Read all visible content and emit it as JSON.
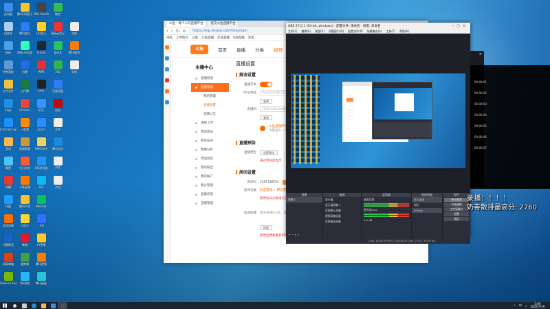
{
  "desktop_icons": [
    {
      "label": "此电脑",
      "color": "#3a8ee6"
    },
    {
      "label": "腾讯QQ音乐",
      "color": "#f4c531"
    },
    {
      "label": "OBS Studio",
      "color": "#444"
    },
    {
      "label": "微信",
      "color": "#2fbf4f"
    },
    {
      "label": "",
      "color": ""
    },
    {
      "label": "回收站",
      "color": "#aaccee"
    },
    {
      "label": "腾讯会议",
      "color": "#2d7cf6"
    },
    {
      "label": "QQ音乐",
      "color": "#fdd12d"
    },
    {
      "label": "网易云音乐",
      "color": "#e33"
    },
    {
      "label": "文档",
      "color": "#eee"
    },
    {
      "label": "网络",
      "color": "#4aa0e6"
    },
    {
      "label": "网易UU加速",
      "color": "#3fb"
    },
    {
      "label": "Steam",
      "color": "#1b2838"
    },
    {
      "label": "爱奇艺",
      "color": "#22c55e"
    },
    {
      "label": "腾讯视频",
      "color": "#ff7b00"
    },
    {
      "label": "控制面板",
      "color": "#5b9bd5"
    },
    {
      "label": "迅雷",
      "color": "#1e6fe6"
    },
    {
      "label": "WPS",
      "color": "#d33"
    },
    {
      "label": "360",
      "color": "#2fb24f"
    },
    {
      "label": "文档",
      "color": "#eee"
    },
    {
      "label": "工作文件",
      "color": "#f0c040"
    },
    {
      "label": "工作簿",
      "color": "#1d7a3f"
    },
    {
      "label": "EPIC",
      "color": "#222"
    },
    {
      "label": "百度网盘",
      "color": "#2f7cf6"
    },
    {
      "label": "",
      "color": ""
    },
    {
      "label": "Edge",
      "color": "#1f8fe0"
    },
    {
      "label": "Chrome",
      "color": "#e8453c"
    },
    {
      "label": "钉钉",
      "color": "#3296fa"
    },
    {
      "label": "网易",
      "color": "#c20c0c"
    },
    {
      "label": "",
      "color": ""
    },
    {
      "label": "Internet Explorer",
      "color": "#1e90ff"
    },
    {
      "label": "一起看",
      "color": "#ff8a00"
    },
    {
      "label": "Zoom",
      "color": "#2d8cff"
    },
    {
      "label": "文件",
      "color": "#eee"
    },
    {
      "label": "",
      "color": ""
    },
    {
      "label": "游戏",
      "color": "#ffb84d"
    },
    {
      "label": "英雄联盟",
      "color": "#c89b3c"
    },
    {
      "label": "WeGame",
      "color": "#f0d060"
    },
    {
      "label": "腾讯文档",
      "color": "#1e88e5"
    },
    {
      "label": "",
      "color": ""
    },
    {
      "label": "截图",
      "color": "#4fc3f7"
    },
    {
      "label": "金山文档",
      "color": "#ff5a36"
    },
    {
      "label": "QQ浏览器",
      "color": "#2196f3"
    },
    {
      "label": "PPT",
      "color": "#eee"
    },
    {
      "label": "",
      "color": ""
    },
    {
      "label": "快播",
      "color": "#e53935"
    },
    {
      "label": "斗鱼直播",
      "color": "#ff7a00"
    },
    {
      "label": "QQ",
      "color": "#12b7f5"
    },
    {
      "label": "文档",
      "color": "#eee"
    },
    {
      "label": "",
      "color": ""
    },
    {
      "label": "优酷",
      "color": "#1e9bff"
    },
    {
      "label": "腾讯手游",
      "color": "#fbc02d"
    },
    {
      "label": "WeChat",
      "color": "#07c160"
    },
    {
      "label": "",
      "color": ""
    },
    {
      "label": "",
      "color": ""
    },
    {
      "label": "游戏加速",
      "color": "#ff6f00"
    },
    {
      "label": "斗地主",
      "color": "#fdd835"
    },
    {
      "label": "飞书",
      "color": "#3370ff"
    },
    {
      "label": "",
      "color": ""
    },
    {
      "label": "",
      "color": ""
    },
    {
      "label": "迅雷影音",
      "color": "#1565c0"
    },
    {
      "label": "微博",
      "color": "#e6162d"
    },
    {
      "label": "YY直播",
      "color": "#ffca28"
    },
    {
      "label": "",
      "color": ""
    },
    {
      "label": "",
      "color": ""
    },
    {
      "label": "网易邮箱",
      "color": "#d84315"
    },
    {
      "label": "爱剪辑",
      "color": "#43a047"
    },
    {
      "label": "腾讯视频",
      "color": "#ff7b00"
    },
    {
      "label": "",
      "color": ""
    },
    {
      "label": "",
      "color": ""
    },
    {
      "label": "GeForce Experience",
      "color": "#76b900"
    },
    {
      "label": "QQ游戏",
      "color": "#29b6f6"
    },
    {
      "label": "腾讯桌面",
      "color": "#26c6da"
    },
    {
      "label": "",
      "color": ""
    },
    {
      "label": "",
      "color": ""
    }
  ],
  "browser": {
    "tabs": [
      "斗鱼 - 每个人的直播平台",
      "提交斗鱼直播平台"
    ],
    "url": "https://mp.douyu.com/live/main",
    "bookmarks": [
      "书签",
      "上传照片",
      "斗鱼",
      "斗鱼直播",
      "虎牙直播",
      "B站直播",
      "淘宝"
    ],
    "logo": "斗鱼",
    "nav": [
      "首页",
      "直播",
      "分类",
      "视频"
    ],
    "menu_title": "主播中心",
    "menu": [
      {
        "label": "直播频道",
        "state": ""
      },
      {
        "label": "直播管理",
        "state": "active"
      },
      {
        "label": "我的管理",
        "state": "sub"
      },
      {
        "label": "直播设置",
        "state": "sub-orange"
      },
      {
        "label": "直播公告",
        "state": "sub"
      },
      {
        "label": "视频上传",
        "state": ""
      },
      {
        "label": "我的收益",
        "state": ""
      },
      {
        "label": "我的任务",
        "state": ""
      },
      {
        "label": "数据分析",
        "state": ""
      },
      {
        "label": "周边商店",
        "state": ""
      },
      {
        "label": "我的粉丝",
        "state": ""
      },
      {
        "label": "我的账户",
        "state": ""
      },
      {
        "label": "帮分管理",
        "state": ""
      },
      {
        "label": "直播权限",
        "state": ""
      },
      {
        "label": "直播管理",
        "state": ""
      }
    ],
    "main_title": "直播设置",
    "section1": "推流设置",
    "live_switch_label": "直播开关",
    "rtmp_label": "rtmp地址",
    "rtmp_value": "rtmp://sendtc3a.douyu.com/live",
    "copy_btn": "复制",
    "code_label": "直播码",
    "code_value": "12051&f55c2bd89b72a2a0",
    "promo_line1": "斗鱼直播伴侣",
    "promo_line2": "功能强大 一键开播",
    "section2": "直播预告",
    "preview_label": "直播预告",
    "preview_btn": "设置预告",
    "preview_hint": "通过审核后显示",
    "section3": "房间设置",
    "room_id_label": "房间ID",
    "room_id_value": "12051&f55c",
    "room_cat_label": "房间分类",
    "room_cat_value": "射击游戏 > 腾讯游戏",
    "room_cat_hint": "修改房间分类请点击",
    "room_title_label": "房间标题",
    "room_title_hint": "每天直播4小时，直播中...",
    "edit_btn": "修改",
    "bottom_hint": "修改后需要重新审核 每天可修改3次"
  },
  "obs": {
    "title": "OBS 27.0.1 (64-bit, windows) - 配置文件: 未命名 - 场景: 未命名",
    "menu": [
      "文件(F)",
      "编辑(E)",
      "视图(V)",
      "停靠窗口(D)",
      "配置文件(P)",
      "场景集合(S)",
      "工具(T)",
      "帮助(H)"
    ],
    "docks": [
      {
        "title": "场景",
        "items": [
          "场景 1"
        ]
      },
      {
        "title": "来源",
        "items": [
          "显示器",
          "显示器采集 1",
          "音频输入采集",
          "视频采集设备",
          "音频输出采集"
        ]
      },
      {
        "title": "混音器",
        "items": [
          "桌面音频",
          "麦克风/Aux",
          "0.0 dB"
        ]
      },
      {
        "title": "转场特效",
        "items": [
          "淡入淡出",
          "时长",
          "300ms"
        ]
      },
      {
        "title": "控件",
        "items": [
          "停止推流",
          "开始录制",
          "工作室模式",
          "设置",
          "退出"
        ]
      }
    ],
    "status": "LIVE: 00:00:00  REC: 00:00:00  CPU: 2.5%, 30.00 fps"
  },
  "timers": [
    "00:00:01",
    "00:00:02",
    "00:00:03",
    "00:00:04",
    "00:00:05",
    "00:00:06",
    "00:00:07"
  ],
  "overlay": {
    "line1": "录播！！！！",
    "line2": "奶毒散排最高分: 2760"
  },
  "taskbar": {
    "time": "3:09",
    "date": "2022/7/19",
    "tray": [
      "^",
      "中",
      "♪"
    ]
  }
}
